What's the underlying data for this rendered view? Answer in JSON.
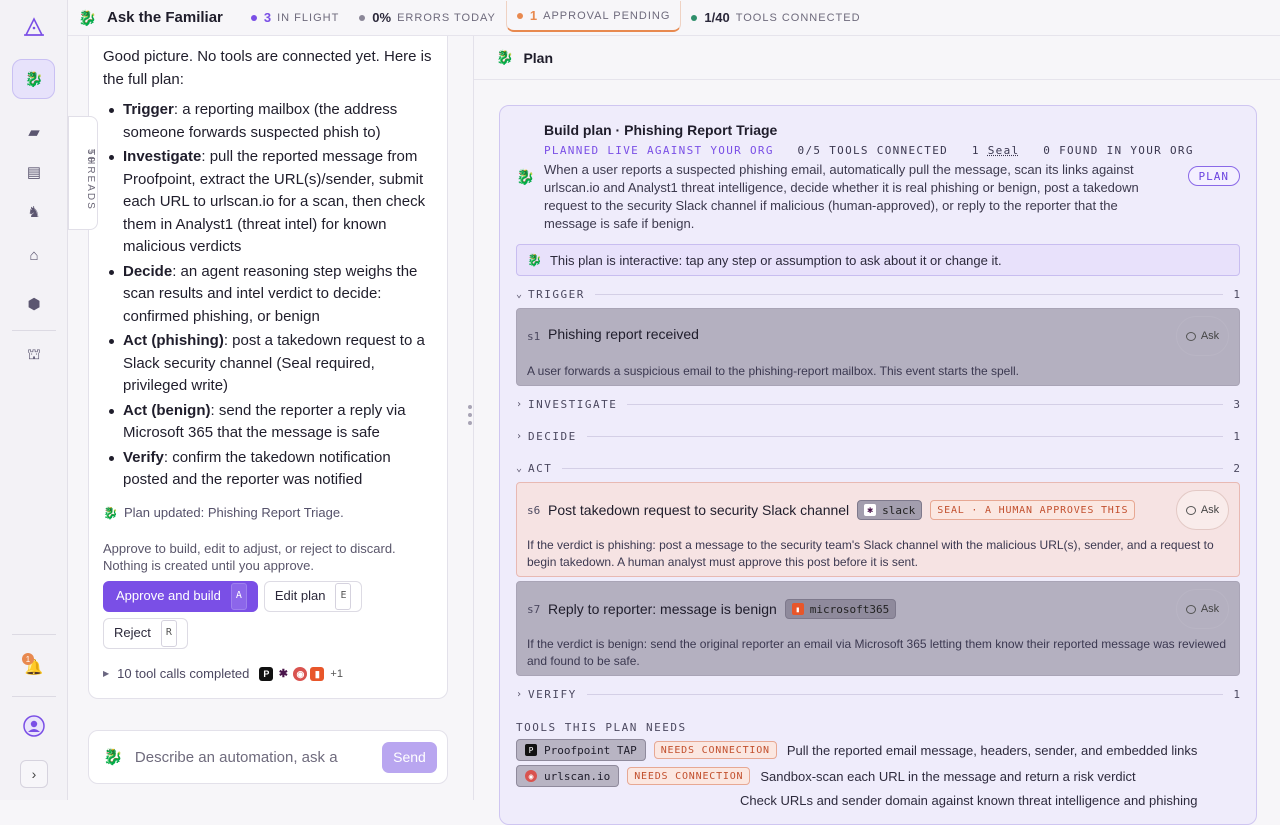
{
  "app": {
    "title": "Ask the Familiar"
  },
  "stats": [
    {
      "value": "3",
      "label": "IN FLIGHT",
      "color": "#7a4fe6"
    },
    {
      "value": "0%",
      "label": "ERRORS TODAY",
      "color": "#8b8798"
    },
    {
      "value": "1",
      "label": "APPROVAL PENDING",
      "color": "#e8894f"
    },
    {
      "value": "1/40",
      "label": "TOOLS CONNECTED",
      "color": "#2f8f6b"
    }
  ],
  "rail": {
    "notification_count": "1"
  },
  "threads": {
    "label": "THREADS",
    "count": "50"
  },
  "chat": {
    "intro": "Good picture. No tools are connected yet. Here is the full plan:",
    "bullets": [
      {
        "term": "Trigger",
        "text": ": a reporting mailbox (the address someone forwards suspected phish to)"
      },
      {
        "term": "Investigate",
        "text": ": pull the reported message from Proofpoint, extract the URL(s)/sender, submit each URL to urlscan.io for a scan, then check them in Analyst1 (threat intel) for known malicious verdicts"
      },
      {
        "term": "Decide",
        "text": ": an agent reasoning step weighs the scan results and intel verdict to decide: confirmed phishing, or benign"
      },
      {
        "term": "Act (phishing)",
        "text": ": post a takedown request to a Slack security channel (Seal required, privileged write)"
      },
      {
        "term": "Act (benign)",
        "text": ": send the reporter a reply via Microsoft 365 that the message is safe"
      },
      {
        "term": "Verify",
        "text": ": confirm the takedown notification posted and the reporter was notified"
      }
    ],
    "plan_updated": "Plan updated: Phishing Report Triage.",
    "note": "Approve to build, edit to adjust, or reject to discard. Nothing is created until you approve.",
    "approve_label": "Approve and build",
    "approve_key": "A",
    "edit_label": "Edit plan",
    "edit_key": "E",
    "reject_label": "Reject",
    "reject_key": "R",
    "tool_calls": "10 tool calls completed",
    "tool_calls_more": "+1"
  },
  "composer": {
    "placeholder": "Describe an automation, ask a",
    "send_label": "Send"
  },
  "plan": {
    "header": "Plan",
    "title": "Build plan · Phishing Report Triage",
    "sub_live": "PLANNED LIVE AGAINST YOUR ORG",
    "sub_tools": "0/5 TOOLS CONNECTED",
    "sub_seal_count": "1",
    "sub_seal": "Seal",
    "sub_found": "0 FOUND IN YOUR ORG",
    "badge": "PLAN",
    "description": "When a user reports a suspected phishing email, automatically pull the message, scan its links against urlscan.io and Analyst1 threat intelligence, decide whether it is real phishing or benign, post a takedown request to the security Slack channel if malicious (human-approved), or reply to the reporter that the message is safe if benign.",
    "interactive_hint": "This plan is interactive: tap any step or assumption to ask about it or change it.",
    "sections": {
      "trigger": {
        "label": "TRIGGER",
        "count": "1"
      },
      "investigate": {
        "label": "INVESTIGATE",
        "count": "3"
      },
      "decide": {
        "label": "DECIDE",
        "count": "1"
      },
      "act": {
        "label": "ACT",
        "count": "2"
      },
      "verify": {
        "label": "VERIFY",
        "count": "1"
      }
    },
    "steps": {
      "s1": {
        "id": "s1",
        "title": "Phishing report received",
        "desc": "A user forwards a suspicious email to the phishing-report mailbox. This event starts the spell.",
        "ask": "Ask"
      },
      "s6": {
        "id": "s6",
        "title": "Post takedown request to security Slack channel",
        "tool": "slack",
        "seal": "SEAL · A HUMAN APPROVES THIS",
        "desc": "If the verdict is phishing: post a message to the security team's Slack channel with the malicious URL(s), sender, and a request to begin takedown. A human analyst must approve this post before it is sent.",
        "ask": "Ask"
      },
      "s7": {
        "id": "s7",
        "title": "Reply to reporter: message is benign",
        "tool": "microsoft365",
        "desc": "If the verdict is benign: send the original reporter an email via Microsoft 365 letting them know their reported message was reviewed and found to be safe.",
        "ask": "Ask"
      }
    },
    "tools_heading": "TOOLS THIS PLAN NEEDS",
    "tools": [
      {
        "name": "Proofpoint TAP",
        "status": "NEEDS CONNECTION",
        "desc": "Pull the reported email message, headers, sender, and embedded links"
      },
      {
        "name": "urlscan.io",
        "status": "NEEDS CONNECTION",
        "desc": "Sandbox-scan each URL in the message and return a risk verdict"
      },
      {
        "desc": "Check URLs and sender domain against known threat intelligence and phishing"
      }
    ]
  }
}
